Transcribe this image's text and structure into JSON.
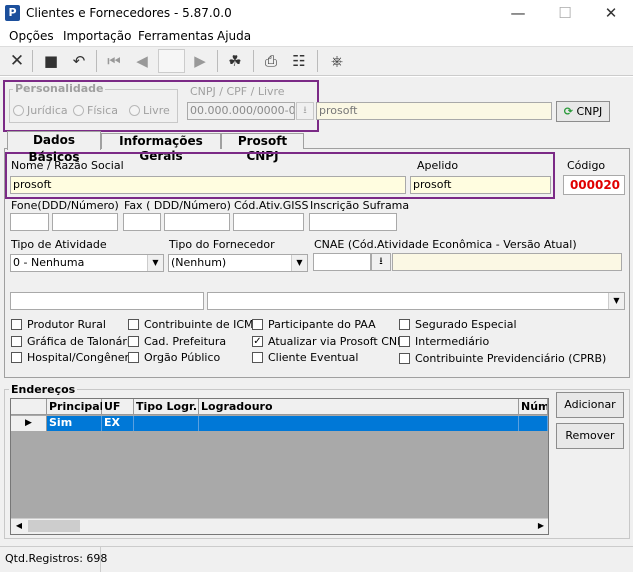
{
  "window": {
    "title": "Clientes e Fornecedores - 5.87.0.0",
    "minimize": "—",
    "maximize": "☐",
    "close": "✕"
  },
  "menu": [
    "Opções",
    "Importação",
    "Ferramentas",
    "Ajuda"
  ],
  "toolbar": {
    "icons": [
      "close-icon",
      "save-icon",
      "undo-icon",
      "first-icon",
      "prior-icon",
      "next-icon",
      "last-icon",
      "people-icon",
      "print-icon",
      "report-icon",
      "exit-icon"
    ],
    "glyphs": {
      "close": "✕",
      "save": "■",
      "undo": "↶",
      "first": "⏮",
      "prior": "◀",
      "next": "▶",
      "last": "⏭",
      "people": "☘",
      "print": "⎙",
      "report": "☷",
      "exit": "⎈"
    }
  },
  "personalidade": {
    "legend": "Personalidade",
    "options": [
      "Jurídica",
      "Física",
      "Livre"
    ]
  },
  "cnpj": {
    "label": "CNPJ / CPF / Livre",
    "mask": "00.000.000/0000-00",
    "name_value": "prosoft",
    "button": "CNPJ"
  },
  "tabs": [
    "Dados Básicos",
    "Informações Gerais",
    "Prosoft CNPJ"
  ],
  "basic": {
    "name_label": "Nome / Razão Social",
    "name_value": "prosoft",
    "apelido_label": "Apelido",
    "apelido_value": "prosoft",
    "codigo_label": "Código",
    "codigo_value": "000020",
    "fone_label": "Fone(DDD/Número)",
    "fax_label": "Fax ( DDD/Número)",
    "ativ_label": "Cód.Ativ.GISS",
    "suframa_label": "Inscrição Suframa",
    "tipo_atividade_label": "Tipo de Atividade",
    "tipo_atividade_value": "0 - Nenhuma",
    "tipo_fornecedor_label": "Tipo do Fornecedor",
    "tipo_fornecedor_value": "(Nenhum)",
    "cnae_label": "CNAE (Cód.Atividade Econômica - Versão Atual)",
    "checks_col1": [
      "Produtor Rural",
      "Gráfica de Talonário",
      "Hospital/Congênere"
    ],
    "checks_col2": [
      "Contribuinte de ICMS",
      "Cad. Prefeitura",
      "Orgão Público"
    ],
    "checks_col3": [
      "Participante do PAA",
      "Atualizar via Prosoft CNPJ",
      "Cliente Eventual"
    ],
    "checks_col4": [
      "Segurado Especial",
      "Intermediário",
      "Contribuinte Previdenciário (CPRB)"
    ],
    "checked": "Atualizar via Prosoft CNPJ"
  },
  "enderecos": {
    "legend": "Endereços",
    "columns": [
      "Principal",
      "UF",
      "Tipo Logr.",
      "Logradouro",
      "Núme"
    ],
    "row": [
      "Sim",
      "EX",
      "",
      "",
      ""
    ],
    "add_button": "Adicionar",
    "remove_button": "Remover"
  },
  "status": {
    "text": "Qtd.Registros: 698"
  },
  "colors": {
    "accent": "#7b2a86",
    "selection": "#0078d7",
    "code": "#e00000"
  }
}
